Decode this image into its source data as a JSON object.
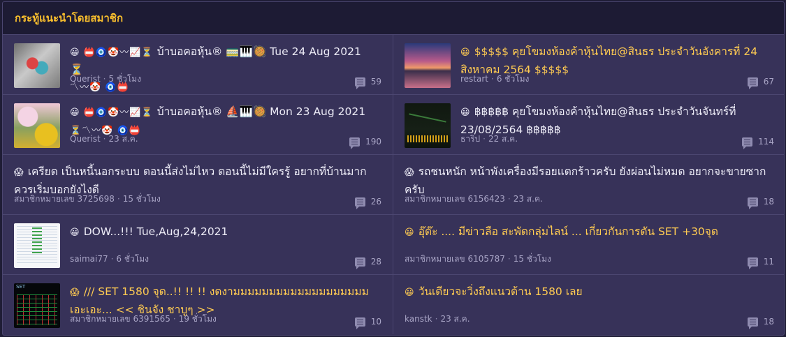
{
  "header": {
    "title": "กระทู้แนะนำโดยสมาชิก"
  },
  "topics": [
    {
      "emoji": "😀 📛🧿🤡〰📈⏳",
      "title": "บ้าบอคอหุ้น® 🚃🎹🥘 Tue 24 Aug 2021 ⏳",
      "line2": "〽〰🤡 🧿📛",
      "gold": false,
      "author": "Querist",
      "time": "5 ชั่วโมง",
      "comments": "59",
      "thumb": "colorful-figure"
    },
    {
      "emoji": "😀",
      "title": "$$$$$ คุยโขมงห้องค้าหุ้นไทย@สินธร ประจำวันอังคารที่ 24 สิงหาคม 2564 $$$$$",
      "gold": true,
      "author": "restart",
      "time": "6 ชั่วโมง",
      "comments": "67",
      "thumb": "sunset"
    },
    {
      "emoji": "😀 📛🧿🤡〰📈⏳",
      "title": "บ้าบอคอหุ้น® ⛵🎹🥘 Mon 23 Aug 2021",
      "line2": "⏳〽〰🤡 🧿📛",
      "gold": false,
      "author": "Querist",
      "time": "23 ส.ค.",
      "comments": "190",
      "thumb": "flowers"
    },
    {
      "emoji": "😀",
      "title": "฿฿฿฿฿ คุยโขมงห้องค้าหุ้นไทย@สินธร ประจำวันจันทร์ที่ 23/08/2564 ฿฿฿฿฿",
      "gold": false,
      "author": "ธาริป",
      "time": "22 ส.ค.",
      "comments": "114",
      "thumb": "stock-chart-dark"
    },
    {
      "emoji": "😱",
      "title": "เครียด เป็นหนี้นอกระบบ ตอนนี้ส่งไม่ไหว ตอนนี้ไม่มีใครรู้ อยากที่บ้านมากควรเริ่มบอกยังไงดี",
      "gold": false,
      "author": "สมาชิกหมายเลข 3725698",
      "time": "15 ชั่วโมง",
      "comments": "26",
      "thumb": ""
    },
    {
      "emoji": "😱",
      "title": "รถชนหนัก หน้าพังเครื่องมีรอยแตกร้าวครับ ยังผ่อนไม่หมด อยากจะขายซากครับ",
      "gold": false,
      "author": "สมาชิกหมายเลข 6156423",
      "time": "23 ส.ค.",
      "comments": "18",
      "thumb": ""
    },
    {
      "emoji": "😀",
      "title": "DOW...!!! Tue,Aug,24,2021",
      "gold": false,
      "author": "saimai77",
      "time": "6 ชั่วโมง",
      "comments": "28",
      "thumb": "stock-table"
    },
    {
      "emoji": "😀",
      "title": "อุ๊ต๊ะ .... มีข่าวลือ สะพัดกลุ่มไลน์ ... เกี่ยวกันการดัน SET +30จุด",
      "gold": true,
      "author": "สมาชิกหมายเลข 6105787",
      "time": "15 ชั่วโมง",
      "comments": "11",
      "thumb": ""
    },
    {
      "emoji": "😱",
      "title": "/// SET 1580 จุด..!! !! !! งดงามมมมมมมมมมมมมมมมมมม เอะเอะ... << ชินจัง ชาบูๆ >>",
      "gold": true,
      "author": "สมาชิกหมายเลข 6391565",
      "time": "19 ชั่วโมง",
      "comments": "10",
      "thumb": "set-index-chart"
    },
    {
      "emoji": "😀",
      "title": "วันเดียวจะวิ่งถึงแนวต้าน 1580 เลย",
      "gold": true,
      "author": "kanstk",
      "time": "23 ส.ค.",
      "comments": "18",
      "thumb": ""
    }
  ]
}
